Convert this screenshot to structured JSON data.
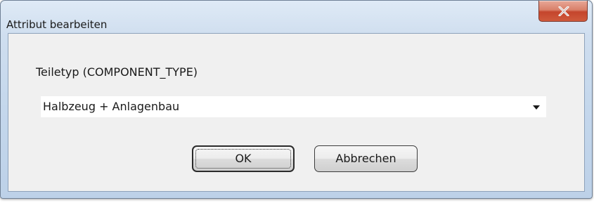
{
  "window": {
    "title": "Attribut bearbeiten"
  },
  "close_icon": "close-icon",
  "field": {
    "label": "Teiletyp (COMPONENT_TYPE)",
    "value": "Halbzeug + Anlagenbau"
  },
  "buttons": {
    "ok_label": "OK",
    "cancel_label": "Abbrechen"
  },
  "colors": {
    "close_button": "#c4452c",
    "frame": "#c4d7ec",
    "client": "#f0f0f0"
  }
}
